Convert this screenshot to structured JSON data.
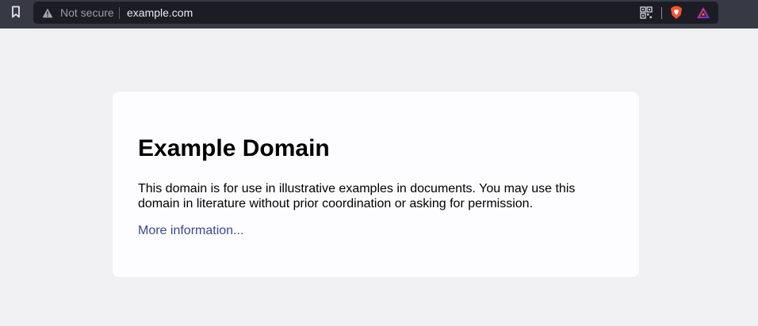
{
  "browser": {
    "security_label": "Not secure",
    "url": "example.com",
    "icons": {
      "bookmark": "bookmark-icon",
      "warning": "warning-triangle-icon",
      "qr": "qr-code-icon",
      "brave": "brave-shields-icon",
      "rewards": "brave-rewards-icon"
    },
    "colors": {
      "toolbar": "#373a45",
      "omnibox": "#1c1d24",
      "brave_orange": "#fb542b"
    }
  },
  "page": {
    "title": "Example Domain",
    "body": "This domain is for use in illustrative examples in documents. You may use this domain in literature without prior coordination or asking for permission.",
    "link_text": "More information...",
    "colors": {
      "background": "#f0f0f2",
      "card": "#fdfdff",
      "link": "#38488f"
    }
  }
}
